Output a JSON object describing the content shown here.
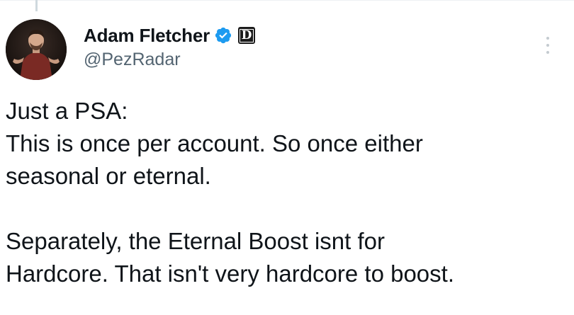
{
  "tweet": {
    "author": {
      "display_name": "Adam Fletcher",
      "handle": "@PezRadar",
      "verified": true,
      "affiliate_badge": "D"
    },
    "body_lines": [
      "Just a PSA:",
      "This is once per account. So once either",
      "seasonal or eternal.",
      "",
      "Separately, the Eternal Boost isnt for",
      "Hardcore. That isn't very hardcore to boost."
    ]
  },
  "colors": {
    "text": "#0f1419",
    "secondary_text": "#536471",
    "verified_blue": "#1d9bf0",
    "badge_bg": "#1b1b1b"
  },
  "icons": {
    "verified": "verified-badge-icon",
    "more": "more-options-icon"
  }
}
